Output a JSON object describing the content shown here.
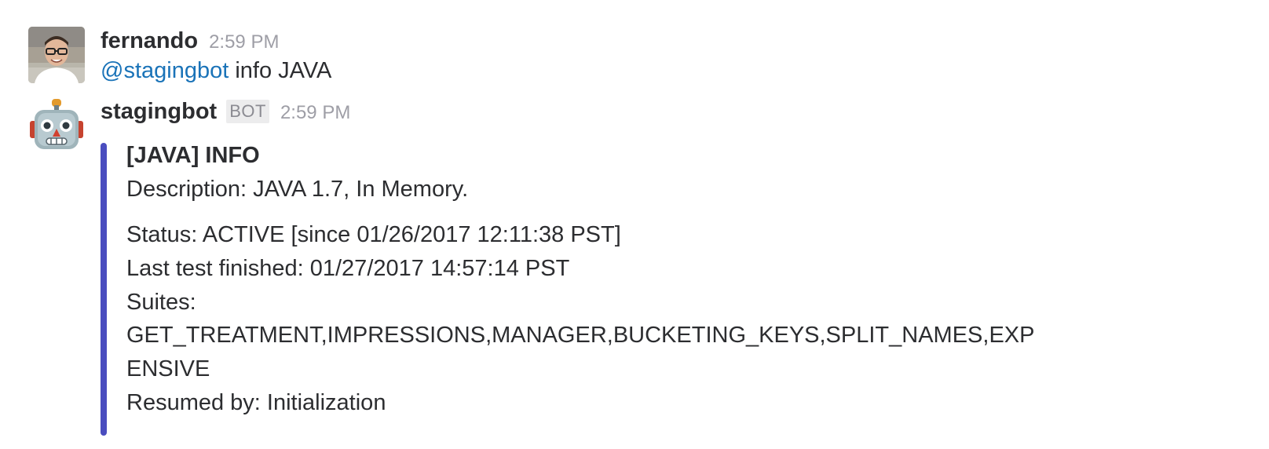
{
  "messages": [
    {
      "username": "fernando",
      "time": "2:59 PM",
      "mention": "@stagingbot",
      "text": " info JAVA"
    },
    {
      "username": "stagingbot",
      "badge": "BOT",
      "time": "2:59 PM",
      "attachment": {
        "accent_color": "#4a4dbf",
        "title": "[JAVA] INFO",
        "lines": [
          "Description: JAVA 1.7, In Memory.",
          "Status: ACTIVE [since 01/26/2017 12:11:38 PST]",
          "Last test finished: 01/27/2017 14:57:14 PST",
          "Suites:",
          "GET_TREATMENT,IMPRESSIONS,MANAGER,BUCKETING_KEYS,SPLIT_NAMES,EXP",
          "ENSIVE",
          "Resumed by: Initialization"
        ]
      }
    }
  ],
  "icons": {
    "user_avatar": "user-photo-avatar",
    "bot_avatar": "robot-face-icon"
  }
}
